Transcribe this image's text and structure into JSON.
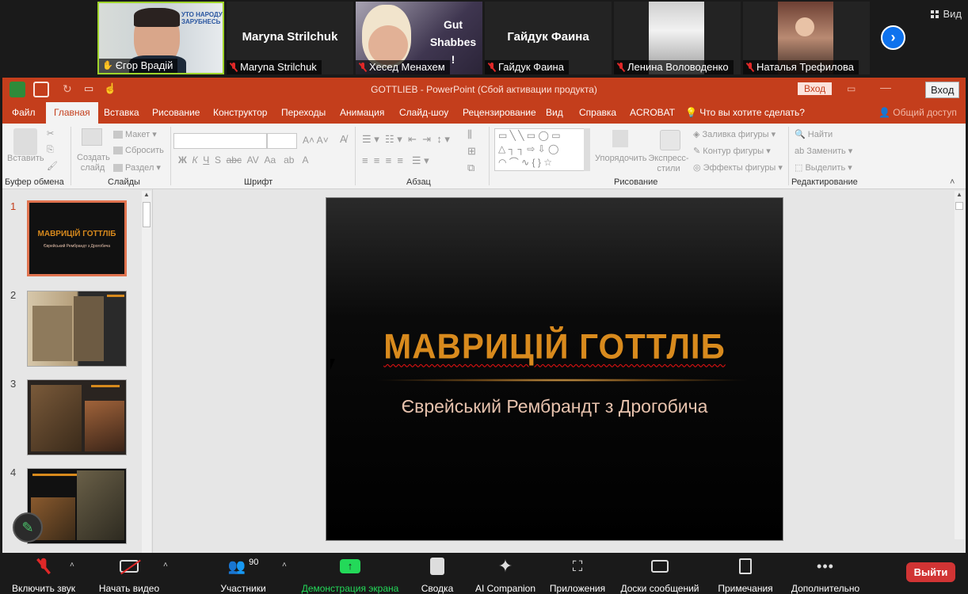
{
  "participants": [
    {
      "name": "Єгор Врадій",
      "video": true
    },
    {
      "name": "Maryna Strilchuk",
      "video": false
    },
    {
      "name": "Хесед Менахем",
      "video": true,
      "overlay_text": "Gut Shabbes !"
    },
    {
      "name": "Гайдук Фаина",
      "video": false
    },
    {
      "name": "Ленина Воловоденко",
      "video": true
    },
    {
      "name": "Наталья Трефилова",
      "video": true
    }
  ],
  "view_label": "Вид",
  "ppt": {
    "title": "GOTTLIEB  -  PowerPoint (Сбой активации продукта)",
    "login": "Вход",
    "login2": "Вход",
    "tabs": [
      "Файл",
      "Главная",
      "Вставка",
      "Рисование",
      "Конструктор",
      "Переходы",
      "Анимация",
      "Слайд-шоу",
      "Рецензирование",
      "Вид",
      "Справка",
      "ACROBAT"
    ],
    "tell_me": "Что вы хотите сделать?",
    "share": "Общий доступ",
    "ribbon": {
      "clipboard": "Буфер обмена",
      "paste": "Вставить",
      "slides": "Слайды",
      "new_slide": "Создать слайд",
      "layout": "Макет",
      "reset": "Сбросить",
      "section": "Раздел",
      "font": "Шрифт",
      "paragraph": "Абзац",
      "drawing": "Рисование",
      "arrange": "Упорядочить",
      "quick_styles": "Экспресс-стили",
      "shape_fill": "Заливка фигуры",
      "shape_outline": "Контур фигуры",
      "shape_effects": "Эффекты фигуры",
      "editing": "Редактирование",
      "find": "Найти",
      "replace": "Заменить",
      "select": "Выделить"
    },
    "slides": [
      {
        "num": "1",
        "title": "МАВРИЦІЙ ГОТТЛІБ",
        "subtitle": "Єврейський Рембрандт з Дрогобича"
      },
      {
        "num": "2"
      },
      {
        "num": "3"
      },
      {
        "num": "4"
      }
    ],
    "current_slide": {
      "title": "МАВРИЦІЙ ГОТТЛІБ",
      "subtitle": "Єврейський Рембрандт з Дрогобича"
    }
  },
  "toolbar": {
    "audio": "Включить звук",
    "video": "Начать видео",
    "participants": "Участники",
    "participants_count": "90",
    "share": "Демонстрация экрана",
    "summary": "Сводка",
    "ai": "AI Companion",
    "apps": "Приложения",
    "whiteboards": "Доски сообщений",
    "notes": "Примечания",
    "more": "Дополнительно",
    "leave": "Выйти"
  },
  "colors": {
    "ppt_accent": "#c43e1c",
    "share_green": "#23d959",
    "leave_red": "#d13434",
    "slide_title": "#d88a1d"
  }
}
